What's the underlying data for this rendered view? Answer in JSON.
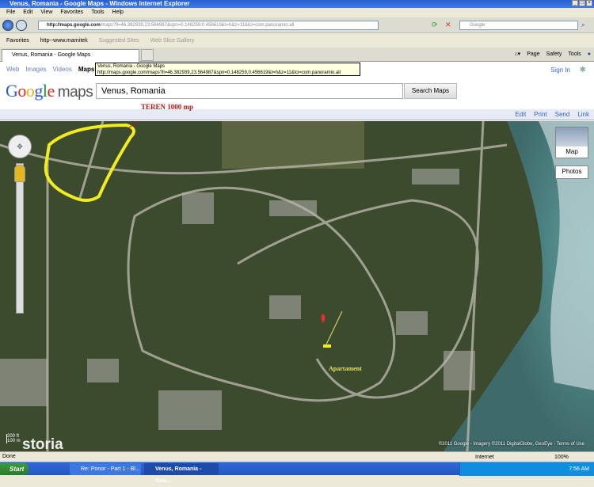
{
  "window": {
    "title": "Venus, Romania - Google Maps - Windows Internet Explorer"
  },
  "menu": [
    "File",
    "Edit",
    "View",
    "Favorites",
    "Tools",
    "Help"
  ],
  "address": {
    "url_host": "http://maps.google.com",
    "url_rest": "/maps?ll=46.382939,23.564987&spn=0.148259,0.456619&t=h&z=11&lci=com.panoramio.all",
    "search_placeholder": "Google"
  },
  "favorites": {
    "label": "Favorites",
    "items": [
      "http--www.marnitek",
      "Suggested Sites",
      "Web Slice Gallery"
    ]
  },
  "tab": {
    "title": "Venus, Romania - Google Maps"
  },
  "commandbar": [
    "Page",
    "Safety",
    "Tools"
  ],
  "tooltip": {
    "line1": "Venus, Romania - Google Maps",
    "line2": "http://maps.google.com/maps?ll=46.382939,23.564987&spn=0.148259,0.456619&t=h&z=11&lci=com.panoramio.all"
  },
  "google": {
    "nav": [
      "Web",
      "Images",
      "Videos",
      "Maps"
    ],
    "sign_in": "Sign In",
    "logo": "Google",
    "logo_suffix": "maps",
    "query": "Venus, Romania",
    "search_button": "Search Maps"
  },
  "maptools": [
    "Edit",
    "Print",
    "Send",
    "Link"
  ],
  "map": {
    "annotation_land": "TEREN 1000 mp",
    "annotation_apartment": "Apartament",
    "map_type": "Map",
    "photos": "Photos",
    "scale_ft": "200 ft",
    "scale_m": "100 m",
    "watermark": "storia",
    "copyright": "©2011 Google - Imagery ©2011 DigitalGlobe, GeoEye - Terms of Use"
  },
  "status": {
    "text": "Done",
    "zone": "Internet",
    "zoom": "100%"
  },
  "taskbar": {
    "start": "Start",
    "tasks": [
      "Re: Ponor - Part 1 - Bl...",
      "Venus, Romania - Goo..."
    ],
    "clock": "7:56 AM"
  }
}
